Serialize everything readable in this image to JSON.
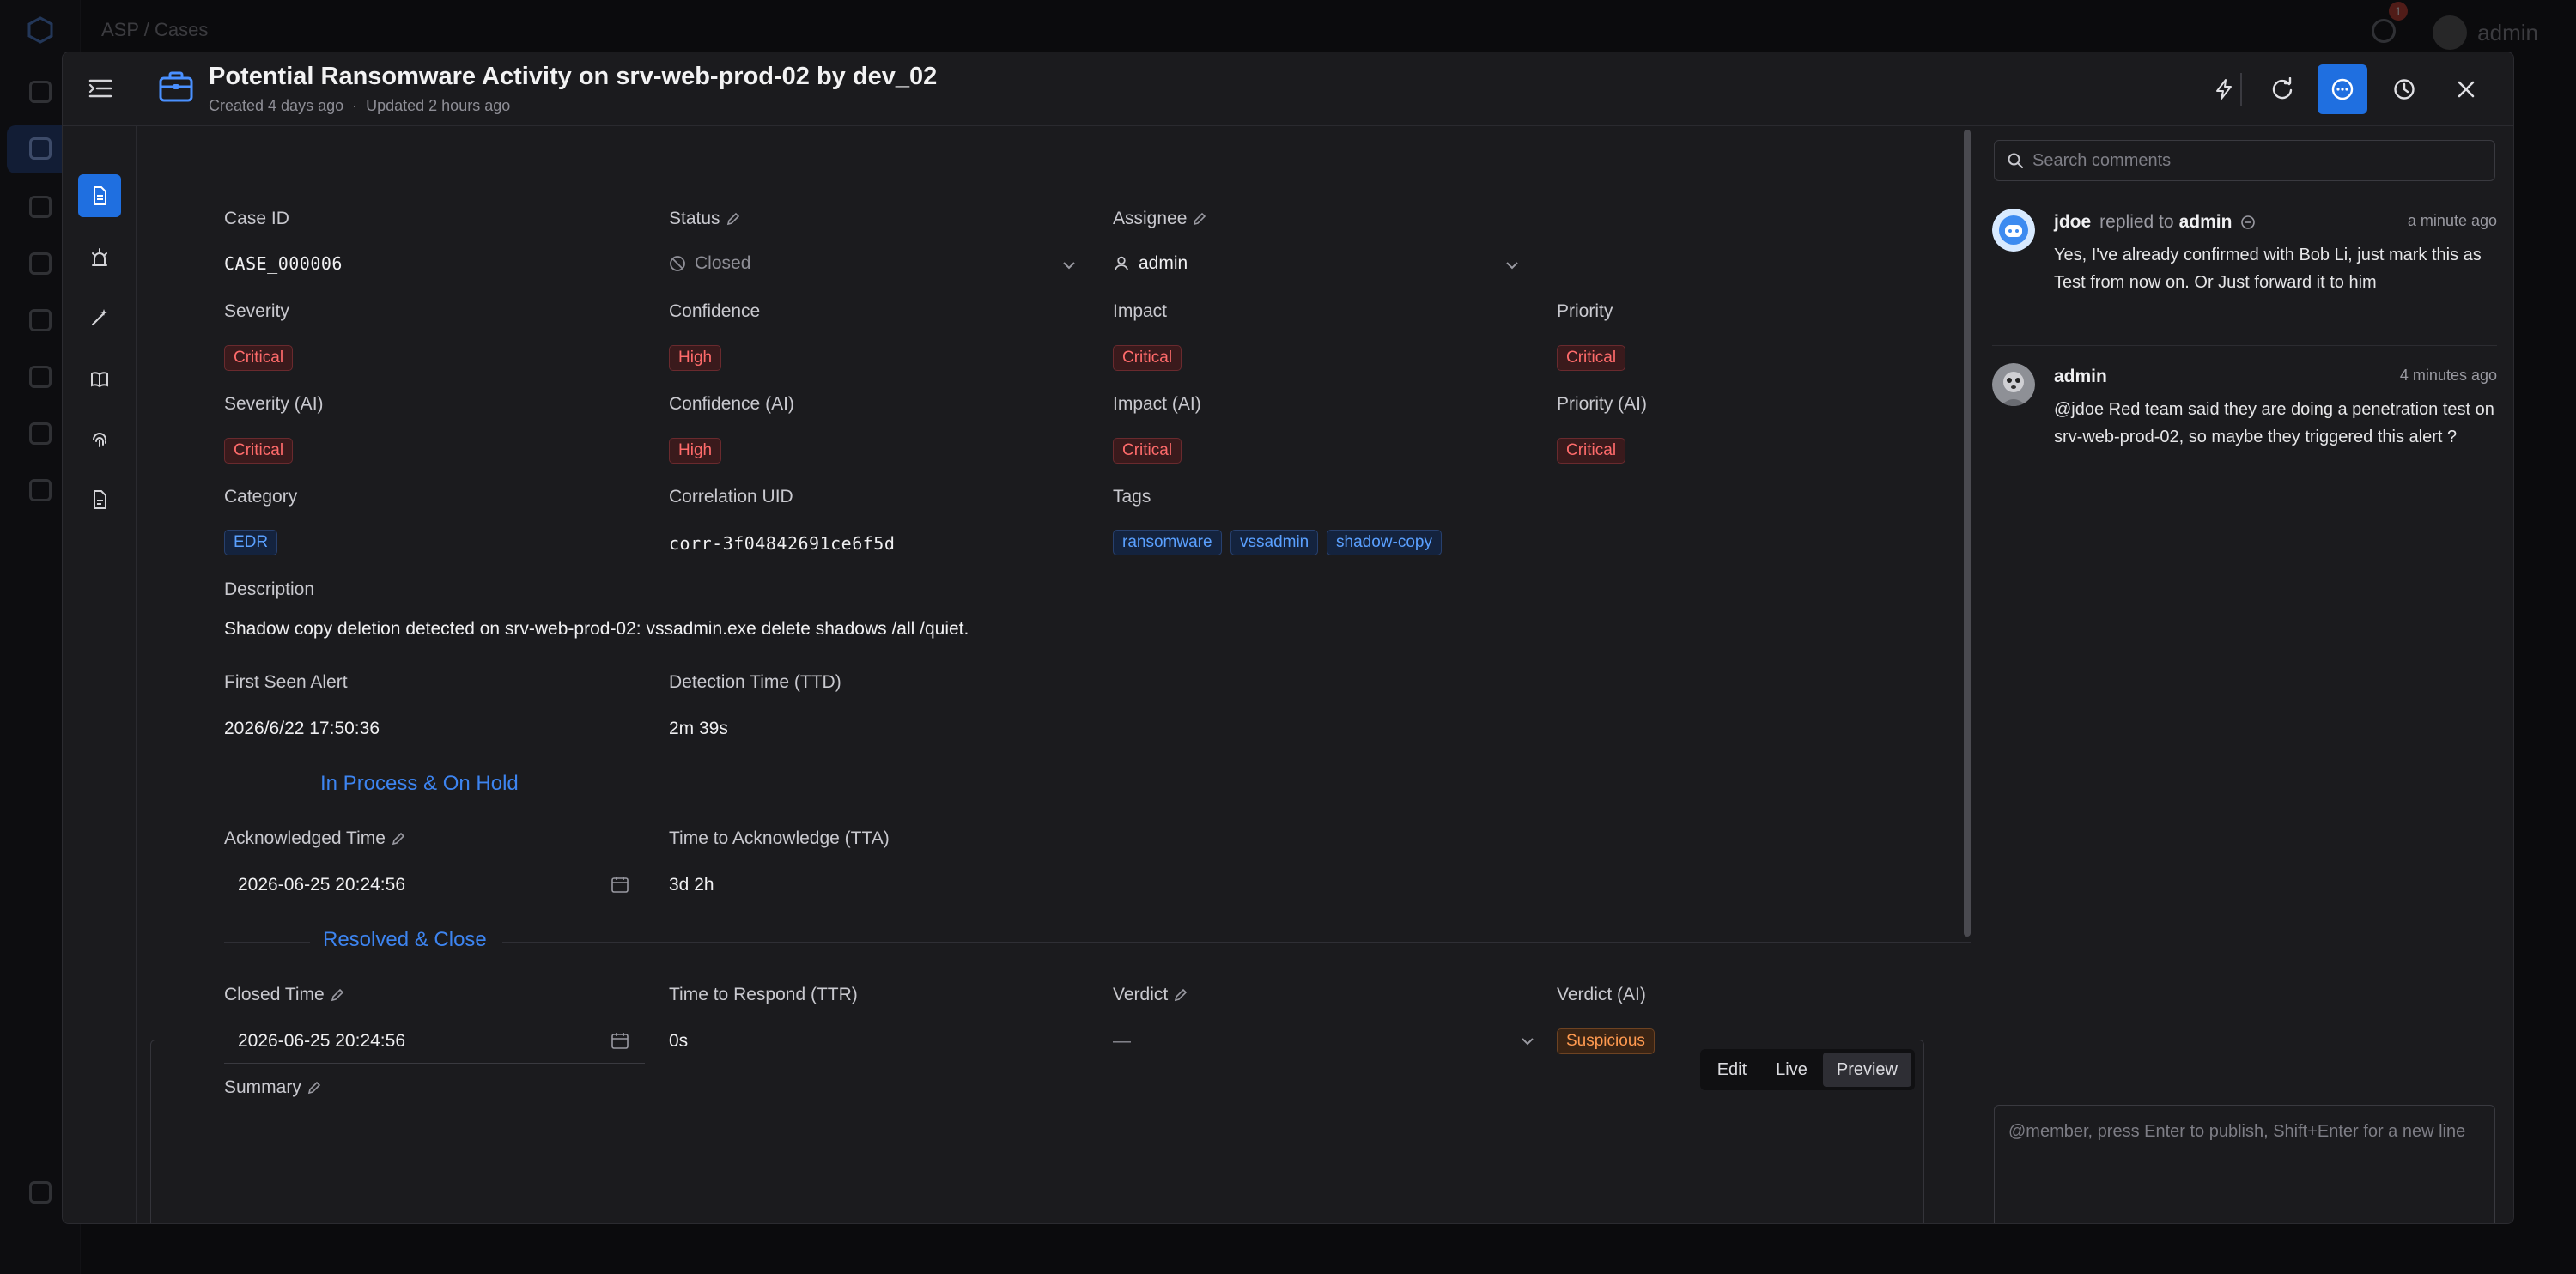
{
  "background": {
    "breadcrumb": "ASP  /  Cases",
    "user_name": "admin",
    "notification_count": "1"
  },
  "header": {
    "title": "Potential Ransomware Activity on srv-web-prod-02 by dev_02",
    "created": "Created 4 days ago",
    "separator": "·",
    "updated": "Updated 2 hours ago"
  },
  "fields": {
    "case_id": {
      "label": "Case ID",
      "value": "CASE_000006"
    },
    "status": {
      "label": "Status",
      "value": "Closed"
    },
    "assignee": {
      "label": "Assignee",
      "value": "admin"
    },
    "severity": {
      "label": "Severity",
      "value": "Critical"
    },
    "confidence": {
      "label": "Confidence",
      "value": "High"
    },
    "impact": {
      "label": "Impact",
      "value": "Critical"
    },
    "priority": {
      "label": "Priority",
      "value": "Critical"
    },
    "severity_ai": {
      "label": "Severity (AI)",
      "value": "Critical"
    },
    "confidence_ai": {
      "label": "Confidence (AI)",
      "value": "High"
    },
    "impact_ai": {
      "label": "Impact (AI)",
      "value": "Critical"
    },
    "priority_ai": {
      "label": "Priority (AI)",
      "value": "Critical"
    },
    "category": {
      "label": "Category",
      "value": "EDR"
    },
    "correlation_uid": {
      "label": "Correlation UID",
      "value": "corr-3f04842691ce6f5d"
    },
    "tags": {
      "label": "Tags",
      "values": [
        "ransomware",
        "vssadmin",
        "shadow-copy"
      ]
    },
    "description": {
      "label": "Description",
      "value": "Shadow copy deletion detected on srv-web-prod-02: vssadmin.exe delete shadows /all /quiet."
    },
    "first_seen": {
      "label": "First Seen Alert",
      "value": "2026/6/22 17:50:36"
    },
    "detection_time": {
      "label": "Detection Time (TTD)",
      "value": "2m 39s"
    }
  },
  "sections": {
    "in_process": "In Process & On Hold",
    "resolved": "Resolved & Close"
  },
  "in_process": {
    "ack_time": {
      "label": "Acknowledged Time",
      "value": "2026-06-25 20:24:56"
    },
    "tta": {
      "label": "Time to Acknowledge (TTA)",
      "value": "3d 2h"
    }
  },
  "resolved": {
    "closed_time": {
      "label": "Closed Time",
      "value": "2026-06-25 20:24:56"
    },
    "ttr": {
      "label": "Time to Respond (TTR)",
      "value": "0s"
    },
    "verdict": {
      "label": "Verdict",
      "value": "—"
    },
    "verdict_ai": {
      "label": "Verdict (AI)",
      "value": "Suspicious"
    },
    "summary": {
      "label": "Summary"
    }
  },
  "editor_modes": [
    "Edit",
    "Live",
    "Preview"
  ],
  "comments": {
    "search_placeholder": "Search comments",
    "items": [
      {
        "author": "jdoe",
        "replied": "replied to",
        "target": "admin",
        "time": "a minute ago",
        "body": "Yes, I've already confirmed with Bob Li, just mark this as Test from now on. Or Just forward it to him"
      },
      {
        "author": "admin",
        "time": "4 minutes ago",
        "body": "@jdoe Red team said they are doing a penetration test on srv-web-prod-02, so maybe they triggered this alert ?"
      }
    ],
    "composer_placeholder": "@member, press Enter to publish, Shift+Enter for a new line"
  },
  "colors": {
    "accent": "#1f6fe0",
    "section_title": "#3d84f0",
    "critical": "#ff6b6b",
    "suspicious": "#ff9a50",
    "tag": "#5aa0ff"
  }
}
